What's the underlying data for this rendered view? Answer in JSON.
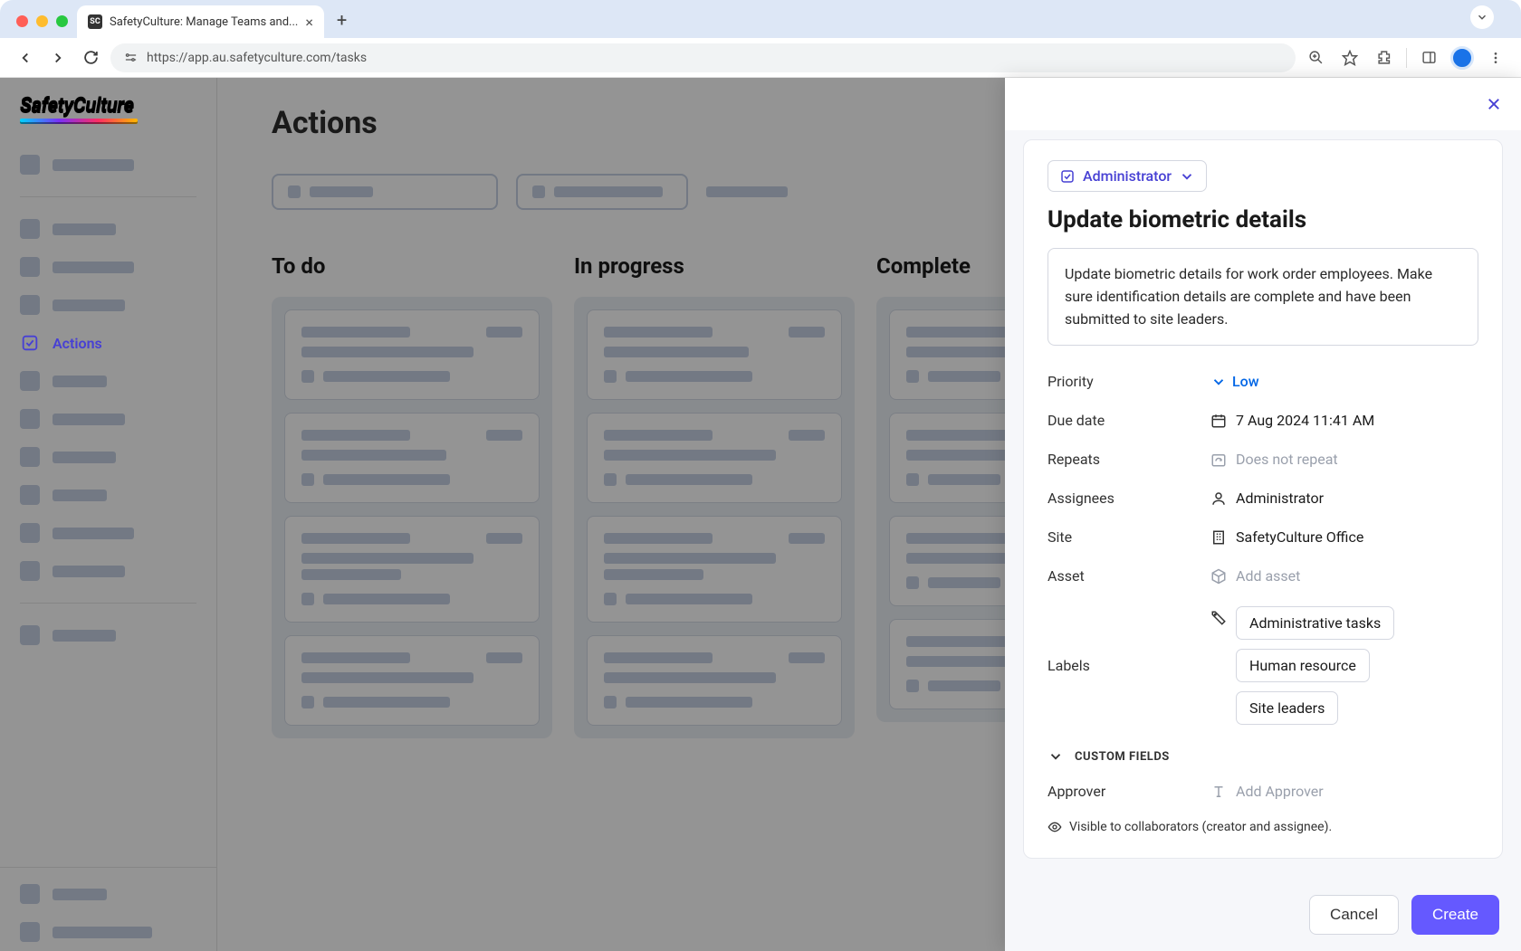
{
  "browser": {
    "tab_title": "SafetyCulture: Manage Teams and...",
    "url": "https://app.au.safetyculture.com/tasks"
  },
  "brand": {
    "name": "SafetyCulture"
  },
  "sidebar": {
    "active_label": "Actions"
  },
  "page": {
    "title": "Actions",
    "columns": {
      "todo": "To do",
      "in_progress": "In progress",
      "complete": "Complete"
    }
  },
  "panel": {
    "creator_chip": "Administrator",
    "title": "Update biometric details",
    "description": "Update biometric details for work order employees. Make sure identification details are complete and have been submitted to site leaders.",
    "fields": {
      "priority": {
        "label": "Priority",
        "value": "Low"
      },
      "due": {
        "label": "Due date",
        "value": "7 Aug 2024 11:41 AM"
      },
      "repeats": {
        "label": "Repeats",
        "placeholder": "Does not repeat"
      },
      "assignees": {
        "label": "Assignees",
        "value": "Administrator"
      },
      "site": {
        "label": "Site",
        "value": "SafetyCulture Office"
      },
      "asset": {
        "label": "Asset",
        "placeholder": "Add asset"
      },
      "labels": {
        "label": "Labels",
        "items": [
          "Administrative tasks",
          "Human resource",
          "Site leaders"
        ]
      }
    },
    "custom_fields_heading": "CUSTOM FIELDS",
    "approver": {
      "label": "Approver",
      "placeholder": "Add Approver"
    },
    "visibility": "Visible to collaborators (creator and assignee).",
    "buttons": {
      "cancel": "Cancel",
      "create": "Create"
    }
  },
  "colors": {
    "accent": "#6559ff",
    "link_blue": "#0066e6"
  }
}
